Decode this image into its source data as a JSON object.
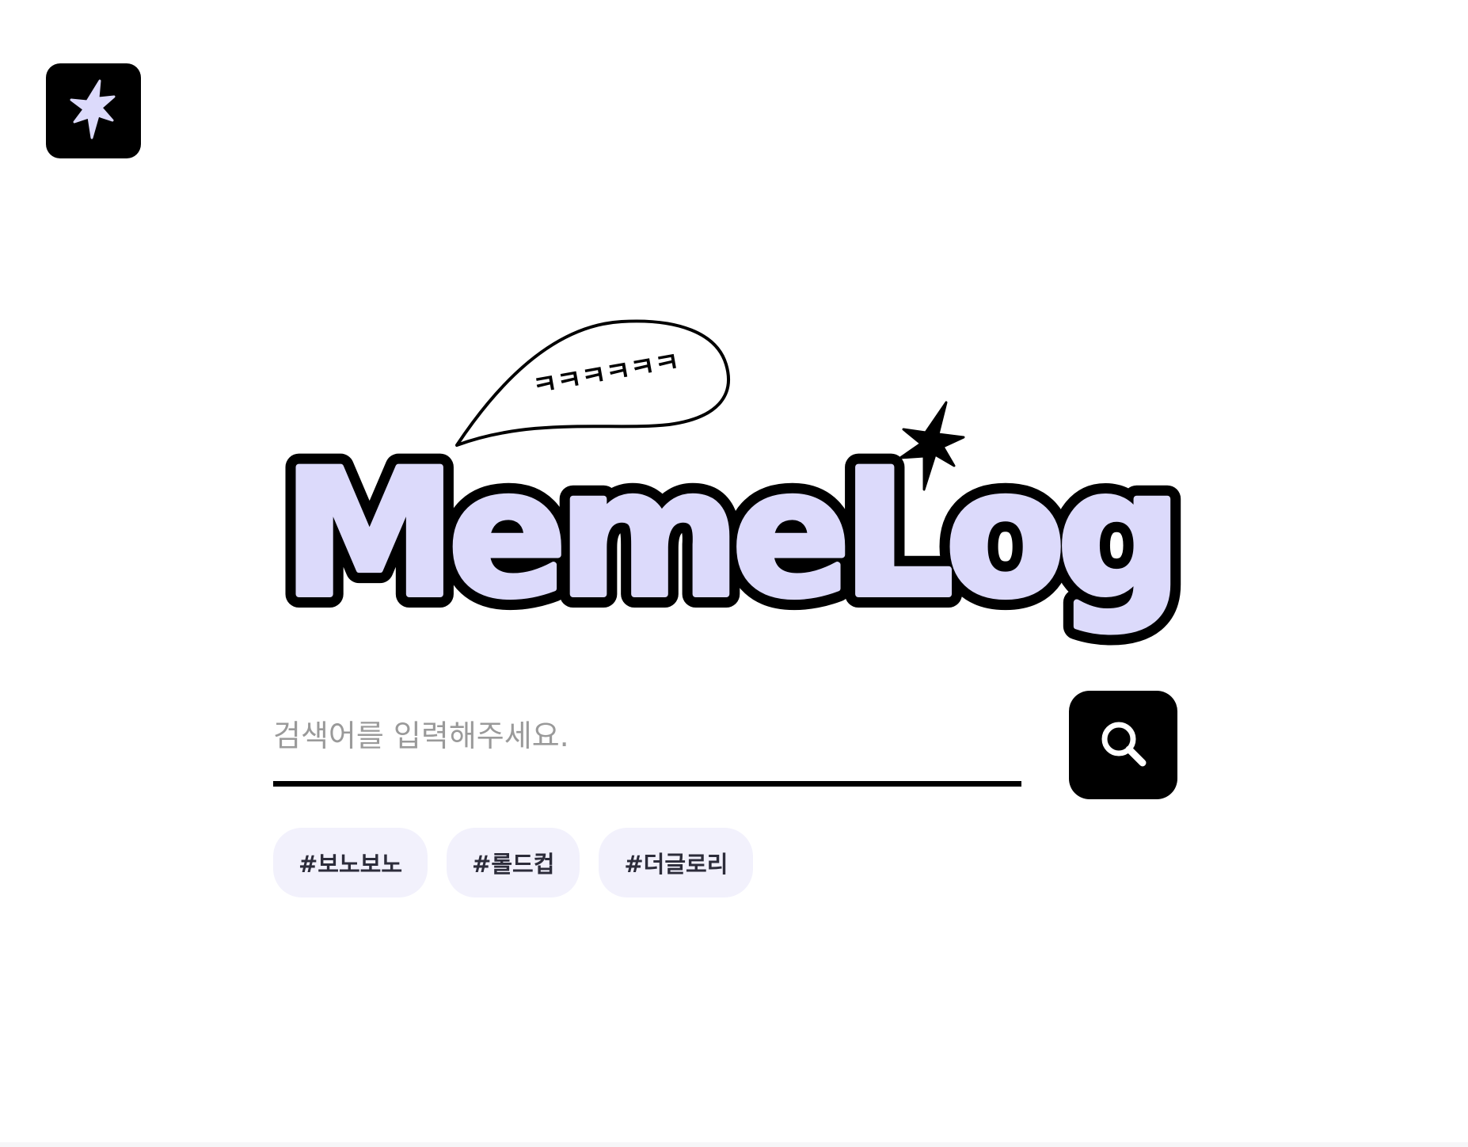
{
  "app": {
    "logo_text": "MemeLog",
    "logo_bubble_text": "ㅋㅋㅋㅋㅋㅋ"
  },
  "header": {
    "home_icon": "sparkle-star-icon"
  },
  "search": {
    "placeholder": "검색어를 입력해주세요.",
    "value": "",
    "button_icon": "search-icon"
  },
  "tags": [
    {
      "label": "#보노보노"
    },
    {
      "label": "#롤드컵"
    },
    {
      "label": "#더글로리"
    }
  ],
  "colors": {
    "brand_fill": "#dcdafb",
    "black": "#000000",
    "tag_bg": "#f2f1fc",
    "placeholder": "#9a9a9a"
  }
}
